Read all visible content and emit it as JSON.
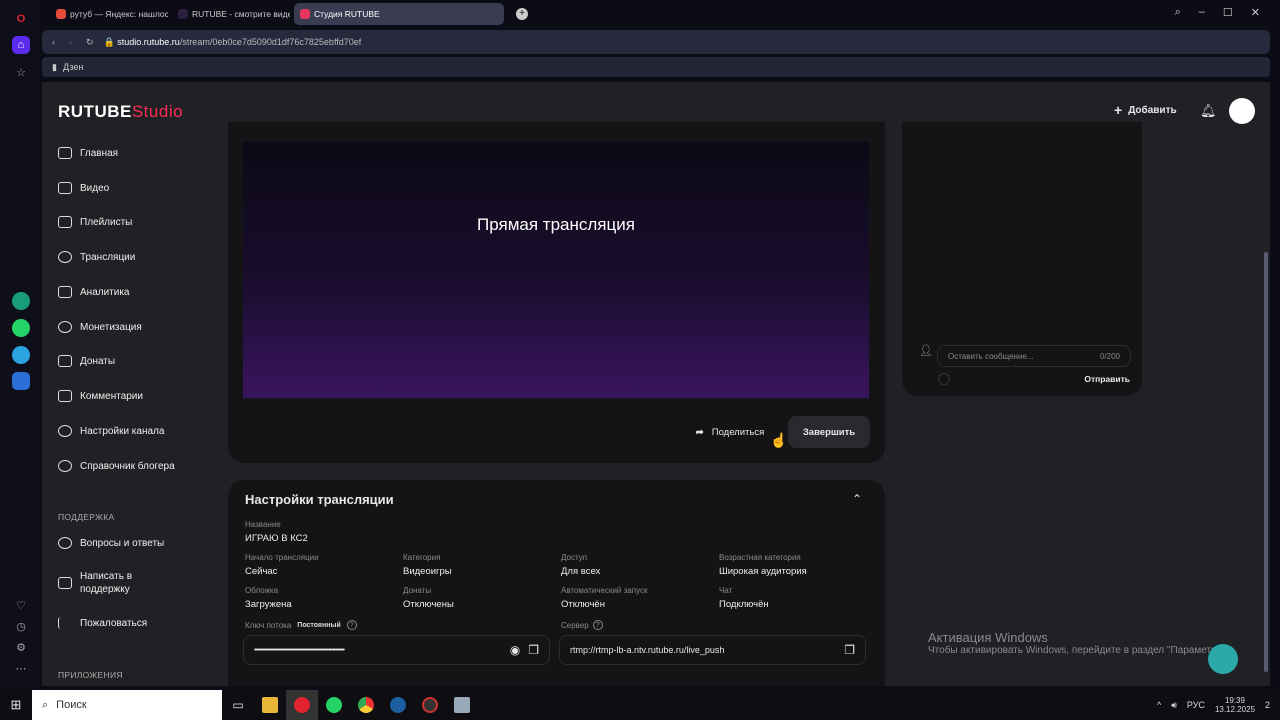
{
  "browser": {
    "tabs": [
      {
        "label": "рутуб — Яндекс: нашлос"
      },
      {
        "label": "RUTUBE - смотрите виде"
      },
      {
        "label": "Студия RUTUBE"
      }
    ],
    "url_domain": "studio.rutube.ru",
    "url_path": "/stream/0eb0ce7d5090d1df76c7825ebffd70ef",
    "bookmark": "Дзен"
  },
  "header": {
    "logo_main": "RUTUBE",
    "logo_sub": "Studio",
    "add_label": "Добавить"
  },
  "sidebar": {
    "items": [
      {
        "label": "Главная"
      },
      {
        "label": "Видео"
      },
      {
        "label": "Плейлисты"
      },
      {
        "label": "Трансляции"
      },
      {
        "label": "Аналитика"
      },
      {
        "label": "Монетизация"
      },
      {
        "label": "Донаты"
      },
      {
        "label": "Комментарии"
      },
      {
        "label": "Настройки канала"
      },
      {
        "label": "Справочник блогера"
      }
    ],
    "support_title": "ПОДДЕРЖКА",
    "support_items": [
      {
        "label": "Вопросы и ответы"
      },
      {
        "label": "Написать в поддержку"
      },
      {
        "label": "Пожаловаться"
      }
    ],
    "apps_title": "ПРИЛОЖЕНИЯ"
  },
  "player": {
    "title": "Прямая трансляция",
    "share_label": "Поделиться",
    "finish_label": "Завершить"
  },
  "chat": {
    "placeholder": "Оставить сообщение...",
    "counter": "0/200",
    "send_label": "Отправить"
  },
  "settings": {
    "title": "Настройки трансляции",
    "name_label": "Название",
    "name_value": "ИГРАЮ В КС2",
    "fields": [
      {
        "label": "Начало трансляции",
        "value": "Сейчас"
      },
      {
        "label": "Категория",
        "value": "Видеоигры"
      },
      {
        "label": "Доступ",
        "value": "Для всех"
      },
      {
        "label": "Возрастная категория",
        "value": "Широкая аудитория"
      },
      {
        "label": "Обложка",
        "value": "Загружена"
      },
      {
        "label": "Донаты",
        "value": "Отключены"
      },
      {
        "label": "Автоматический запуск",
        "value": "Отключён"
      },
      {
        "label": "Чат",
        "value": "Подключён"
      }
    ],
    "key_label": "Ключ потока",
    "key_badge": "Постоянный",
    "key_value": "••••••••••••••••••••••••••••••••••••••••••••••••••••••••••••••",
    "server_label": "Сервер",
    "server_value": "rtmp://rtmp-lb-a.ntv.rutube.ru/live_push"
  },
  "watermark": {
    "title": "Активация Windows",
    "text": "Чтобы активировать Windows, перейдите в раздел \"Параметры\""
  },
  "taskbar": {
    "search": "Поиск",
    "lang": "РУС",
    "time": "19:39",
    "date": "13.12.2025",
    "notif": "2"
  }
}
